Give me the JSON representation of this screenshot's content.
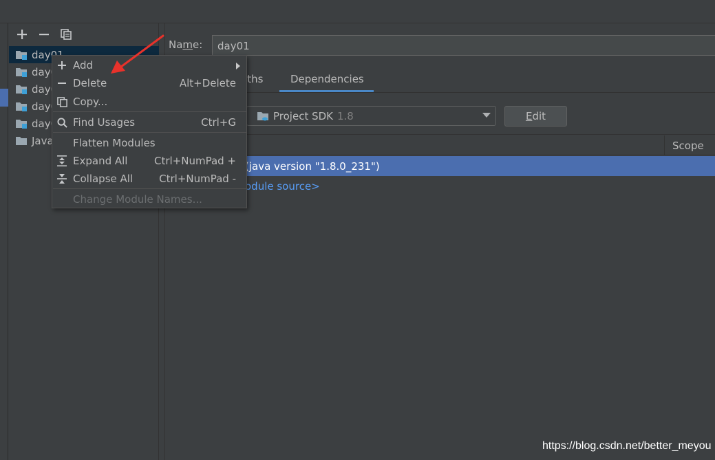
{
  "colors": {
    "background": "#3c3f41",
    "selection": "#4b6eaf",
    "tree_selection": "#0d293e",
    "link": "#589df6",
    "annotation_arrow": "#e8322b",
    "tab_underline": "#4a88c7",
    "module_icon_accent": "#3ea0d6"
  },
  "toolbar": {
    "add_icon": "plus-icon",
    "remove_icon": "minus-icon",
    "copy_icon": "copy-icon"
  },
  "tree": {
    "items": [
      {
        "label": "day01",
        "icon": "module-folder-icon"
      },
      {
        "label": "day0",
        "icon": "module-folder-icon"
      },
      {
        "label": "day0",
        "icon": "module-folder-icon"
      },
      {
        "label": "day0",
        "icon": "module-folder-icon"
      },
      {
        "label": "day0",
        "icon": "module-folder-icon"
      },
      {
        "label": "Java",
        "icon": "folder-icon"
      }
    ]
  },
  "name_field": {
    "label_before": "Na",
    "label_mnemonic": "m",
    "label_after": "e:",
    "value": "day01"
  },
  "tabs": [
    {
      "label": "aths"
    },
    {
      "label": "Dependencies",
      "active": true
    }
  ],
  "sdk": {
    "label": "Project SDK",
    "version": "1.8",
    "edit_mnemonic": "E",
    "edit_rest": "dit"
  },
  "table": {
    "scope_header": "Scope",
    "selected_row": "(java version \"1.8.0_231\")",
    "module_source": "odule source>"
  },
  "context_menu": {
    "items": [
      {
        "label": "Add",
        "shortcut": "",
        "icon": "plus-icon",
        "submenu": true
      },
      {
        "label": "Delete",
        "shortcut": "Alt+Delete",
        "icon": "minus-icon"
      },
      {
        "label": "Copy...",
        "shortcut": "",
        "icon": "copy-icon"
      },
      {
        "label": "Find Usages",
        "shortcut": "Ctrl+G",
        "icon": "search-icon"
      },
      {
        "label": "Flatten Modules",
        "shortcut": "",
        "icon": ""
      },
      {
        "label": "Expand All",
        "shortcut": "Ctrl+NumPad +",
        "icon": "expand-all-icon"
      },
      {
        "label": "Collapse All",
        "shortcut": "Ctrl+NumPad -",
        "icon": "collapse-all-icon"
      },
      {
        "label": "Change Module Names...",
        "shortcut": "",
        "icon": "",
        "disabled": true
      }
    ]
  },
  "watermark": "https://blog.csdn.net/better_meyou"
}
